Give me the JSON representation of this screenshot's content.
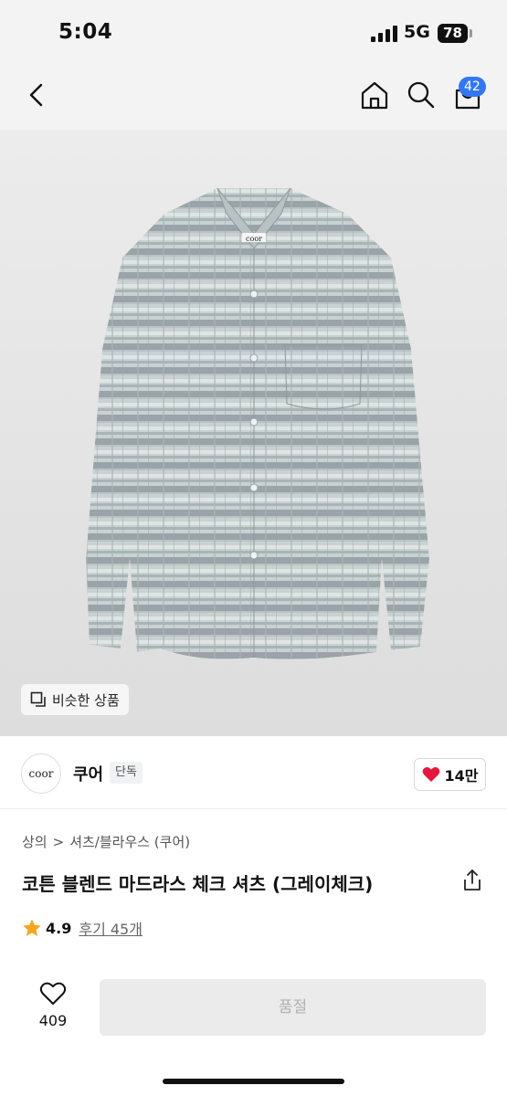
{
  "status_bar": {
    "time": "5:04",
    "network": "5G",
    "battery": "78"
  },
  "nav": {
    "back_icon": "chevron-left-icon",
    "home_icon": "home-icon",
    "search_icon": "search-icon",
    "cart_icon": "shopping-bag-icon",
    "cart_count": "42"
  },
  "product_image": {
    "logo_text": "coor",
    "similar_label": "비슷한 상품"
  },
  "brand": {
    "logo_text": "coor",
    "name": "쿠어",
    "tag": "단독",
    "likes": "14만"
  },
  "breadcrumb": {
    "category": "상의",
    "separator": ">",
    "subcategory": "셔츠/블라우스 (쿠어)"
  },
  "product": {
    "title": "코튼 블렌드 마드라스 체크 셔츠 (그레이체크)"
  },
  "rating": {
    "score": "4.9",
    "reviews": "후기 45개"
  },
  "bottom_bar": {
    "like_count": "409",
    "buy_label": "품절"
  },
  "colors": {
    "accent": "#3477f5",
    "heart": "#e5173f",
    "star": "#f5a623",
    "disabled_bg": "#ebebeb",
    "disabled_text": "#b1b1b1"
  }
}
